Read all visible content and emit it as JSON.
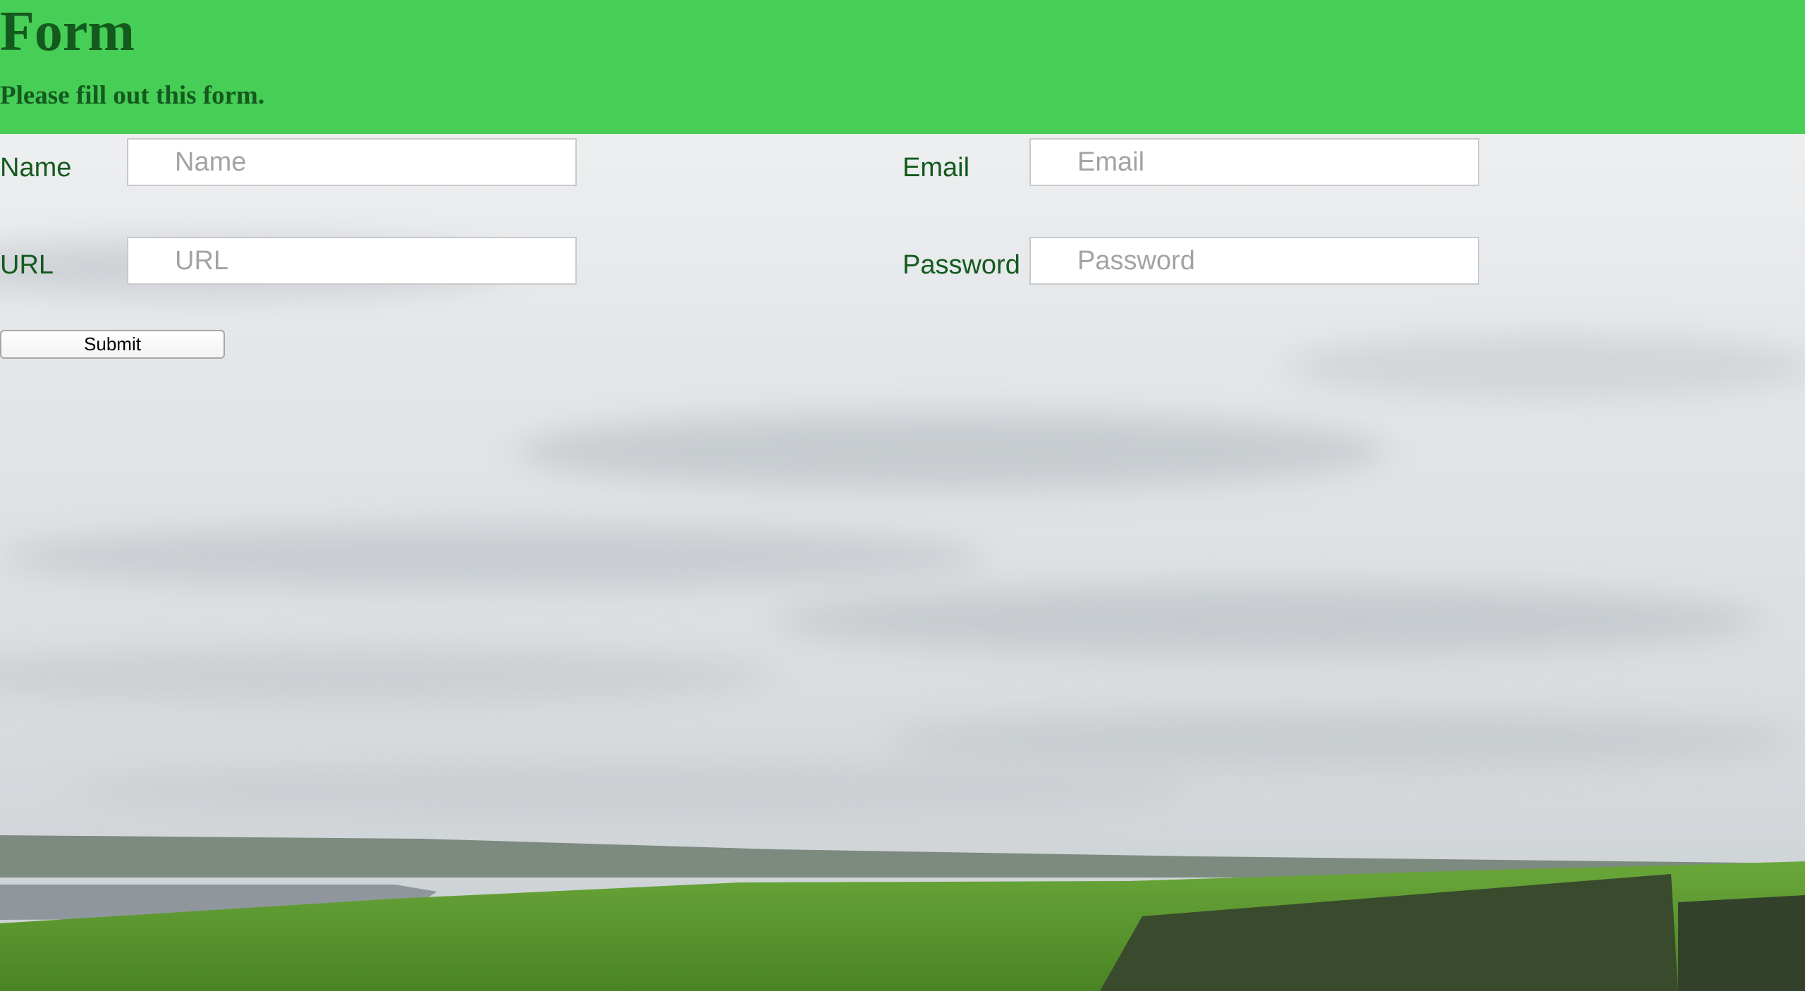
{
  "header": {
    "title": "Form",
    "subtitle": "Please fill out this form.",
    "background_color": "#46ce57",
    "text_color": "#145a1e"
  },
  "form": {
    "name": {
      "label": "Name",
      "placeholder": "Name",
      "value": ""
    },
    "url": {
      "label": "URL",
      "placeholder": "URL",
      "value": ""
    },
    "email": {
      "label": "Email",
      "placeholder": "Email",
      "value": ""
    },
    "password": {
      "label": "Password",
      "placeholder": "Password",
      "value": ""
    },
    "submit_label": "Submit"
  },
  "background": {
    "description_icon": "landscape-photo",
    "sky_color": "#e9ebee",
    "grass_color": "#5f9d2f",
    "sea_color": "#8f979c"
  }
}
